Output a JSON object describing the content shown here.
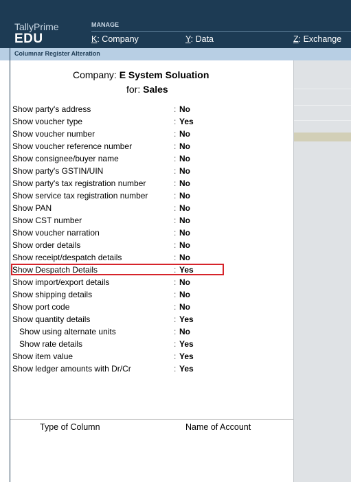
{
  "header": {
    "app_name": "TallyPrime",
    "edition": "EDU",
    "section_label": "MANAGE",
    "menu": [
      {
        "key": "K",
        "label": "Company"
      },
      {
        "key": "Y",
        "label": "Data"
      },
      {
        "key": "Z",
        "label": "Exchange"
      }
    ]
  },
  "subheader": {
    "title": "Columnar Register Alteration"
  },
  "form": {
    "company_label": "Company:",
    "company_name": "E System Soluation",
    "for_label": "for:",
    "for_value": "Sales",
    "separator": ":",
    "options": [
      {
        "label": "Show party's address",
        "value": "No"
      },
      {
        "label": "Show voucher type",
        "value": "Yes"
      },
      {
        "label": "Show voucher number",
        "value": "No"
      },
      {
        "label": "Show voucher reference number",
        "value": "No"
      },
      {
        "label": "Show consignee/buyer name",
        "value": "No"
      },
      {
        "label": "Show party's GSTIN/UIN",
        "value": "No"
      },
      {
        "label": "Show party's tax registration number",
        "value": "No"
      },
      {
        "label": "Show service tax registration number",
        "value": "No"
      },
      {
        "label": "Show PAN",
        "value": "No"
      },
      {
        "label": "Show CST number",
        "value": "No"
      },
      {
        "label": "Show voucher narration",
        "value": "No"
      },
      {
        "label": "Show order details",
        "value": "No"
      },
      {
        "label": "Show receipt/despatch details",
        "value": "No"
      },
      {
        "label": "Show Despatch Details",
        "value": "Yes"
      },
      {
        "label": "Show import/export details",
        "value": "No"
      },
      {
        "label": "Show shipping details",
        "value": "No"
      },
      {
        "label": "Show port code",
        "value": "No"
      },
      {
        "label": "Show quantity details",
        "value": "Yes"
      },
      {
        "label": "Show using alternate units",
        "value": "No"
      },
      {
        "label": "Show rate details",
        "value": "Yes"
      },
      {
        "label": "Show item value",
        "value": "Yes"
      },
      {
        "label": "Show ledger amounts with Dr/Cr",
        "value": "Yes"
      }
    ],
    "table": {
      "col1": "Type of Column",
      "col2": "Name of Account"
    }
  },
  "colors": {
    "header_bg": "#1d3b54",
    "subbar_bg": "#b8cfe4",
    "highlight_border": "#d6242b"
  }
}
